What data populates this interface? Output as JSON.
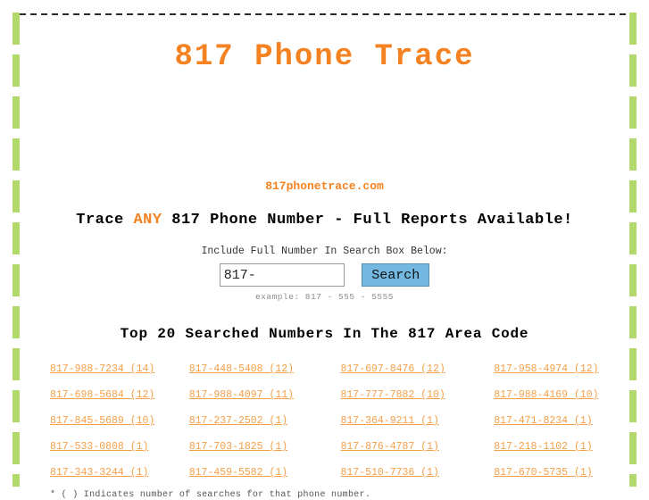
{
  "page": {
    "title": "817 Phone Trace",
    "domain": "817phonetrace.com",
    "accent_orange": "#F58220",
    "link_orange": "#F5A04A",
    "rail_green": "#b3d86b",
    "button_blue": "#72b8e0"
  },
  "tagline": {
    "before": "Trace ",
    "highlight": "ANY",
    "after": " 817 Phone Number - Full Reports Available!"
  },
  "search": {
    "instruction": "Include Full Number In Search Box Below:",
    "input_value": "817-",
    "placeholder": "",
    "button_label": "Search",
    "example": "example: 817 - 555 - 5555"
  },
  "top20": {
    "heading": "Top 20 Searched Numbers In The 817 Area Code",
    "rows": [
      [
        "817-988-7234  (14)",
        "817-448-5408  (12)",
        "817-697-8476  (12)",
        "817-958-4974  (12)"
      ],
      [
        "817-698-5684  (12)",
        "817-988-4097  (11)",
        "817-777-7882  (10)",
        "817-988-4169  (10)"
      ],
      [
        "817-845-5689  (10)",
        "817-237-2502  (1)",
        "817-364-9211  (1)",
        "817-471-8234  (1)"
      ],
      [
        "817-533-0808  (1)",
        "817-703-1825  (1)",
        "817-876-4787  (1)",
        "817-218-1102  (1)"
      ],
      [
        "817-343-3244  (1)",
        "817-459-5582  (1)",
        "817-510-7736  (1)",
        "817-670-5735  (1)"
      ]
    ]
  },
  "footnote": "* ( ) Indicates number of searches for that phone number."
}
